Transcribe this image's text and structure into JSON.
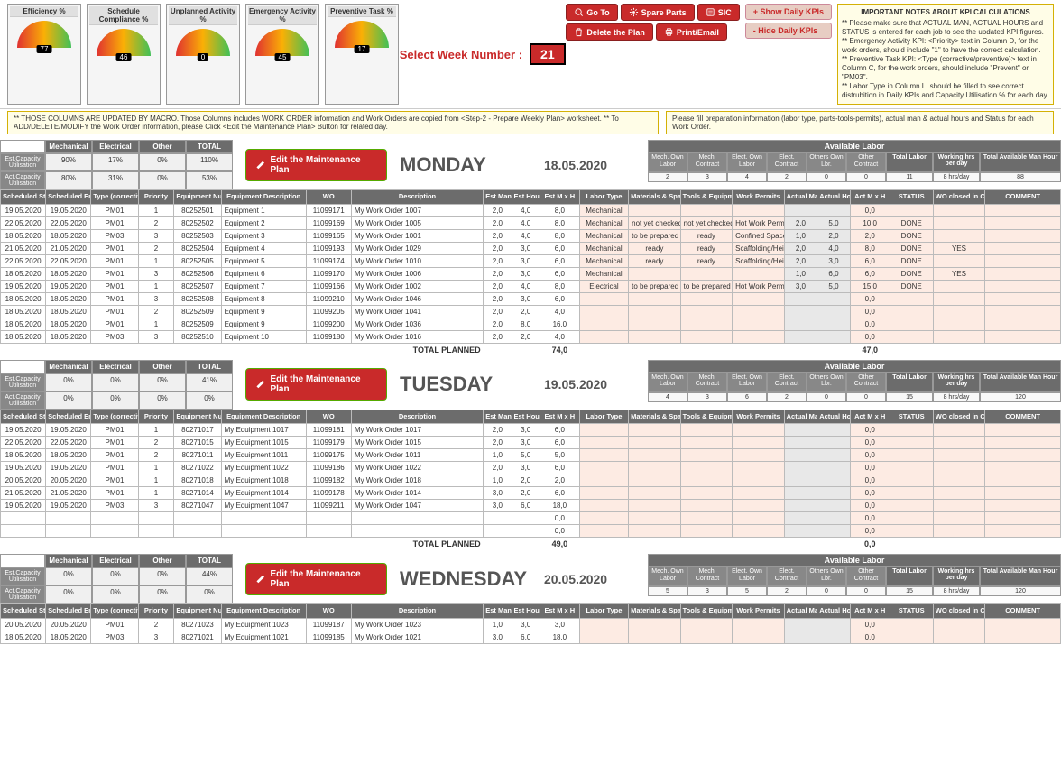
{
  "gauges": [
    {
      "title": "Efficiency %",
      "val": "77"
    },
    {
      "title": "Schedule Compliance %",
      "val": "46"
    },
    {
      "title": "Unplanned Activity %",
      "val": "0"
    },
    {
      "title": "Emergency Activity %",
      "val": "45"
    },
    {
      "title": "Preventive Task %",
      "val": "17"
    }
  ],
  "week_label": "Select Week Number :",
  "week_num": "21",
  "buttons": {
    "goto": "Go To",
    "spare": "Spare Parts",
    "sic": "SIC",
    "delete": "Delete the Plan",
    "print": "Print/Email",
    "show": "+ Show Daily KPIs",
    "hide": "- Hide Daily KPIs"
  },
  "notes": {
    "title": "IMPORTANT NOTES ABOUT KPI CALCULATIONS",
    "l1": "** Please make sure that ACTUAL MAN, ACTUAL HOURS and STATUS is entered for each job to see the updated KPI figures.",
    "l2": "** Emergency Activity KPI: <Priority> text in Column D, for the work orders, should include \"1\" to have the correct calculation.",
    "l3": "** Preventive Task KPI: <Type (corrective/preventive)> text in Column C, for the work orders, should include \"Prevent\" or \"PM03\".",
    "l4": "** Labor Type in Column L, should be filled to see correct distrubition in Daily KPIs and Capacity Utilisation % for each day."
  },
  "legend1": "** THOSE COLUMNS ARE UPDATED BY MACRO. Those Columns includes WORK ORDER information and Work Orders are copied from <Step-2 - Prepare Weekly Plan> worksheet. ** To ADD/DELETE/MODIFY the Work Order information, please Click <Edit the Maintenance Plan> Button for related day.",
  "legend2": "Please fill preparation information (labor type, parts-tools-permits), actual man & actual hours and Status for each Work Order.",
  "edit_label": "Edit the Maintenance Plan",
  "cap_cols": [
    "Mechanical",
    "Electrical",
    "Other",
    "TOTAL"
  ],
  "cap_rows": [
    "Est.Capacity Utilisation",
    "Act.Capacity Utilisation"
  ],
  "avail_title": "Available Labor",
  "avail_cols": [
    "Mech. Own Labor",
    "Mech. Contract",
    "Elect. Own Labor",
    "Elect. Contract",
    "Others Own Lbr.",
    "Other Contract",
    "Total Labor",
    "Working hrs per day",
    "Total Available Man Hour"
  ],
  "th": {
    "sd": "Scheduled Start Date",
    "ed": "Scheduled End Date",
    "type": "Type (corrective / preventive)",
    "pri": "Priority",
    "eqn": "Equipment Number",
    "eqd": "Equipment Description",
    "wo": "WO",
    "desc": "Description",
    "em": "Est Man",
    "eh": "Est Hour",
    "emh": "Est M x H",
    "lt": "Labor Type",
    "mat": "Materials & Spare Parts",
    "tool": "Tools & Equipment",
    "perm": "Work Permits",
    "am": "Actual Man",
    "ah": "Actual Hour",
    "amh": "Act M x H",
    "st": "STATUS",
    "cmms": "WO closed in CMMS?",
    "com": "COMMENT"
  },
  "total_label": "TOTAL PLANNED",
  "days": [
    {
      "name": "MONDAY",
      "date": "18.05.2020",
      "cap": [
        [
          "90%",
          "17%",
          "0%",
          "110%"
        ],
        [
          "80%",
          "31%",
          "0%",
          "53%"
        ]
      ],
      "avail": [
        "2",
        "3",
        "4",
        "2",
        "0",
        "0",
        "11",
        "8 hrs/day",
        "88"
      ],
      "rows": [
        [
          "19.05.2020",
          "19.05.2020",
          "PM01",
          "1",
          "80252501",
          "Equipment 1",
          "11099171",
          "My Work Order 1007",
          "2,0",
          "4,0",
          "8,0",
          "Mechanical",
          "",
          "",
          "",
          "",
          "",
          "0,0",
          "",
          "",
          ""
        ],
        [
          "22.05.2020",
          "22.05.2020",
          "PM01",
          "2",
          "80252502",
          "Equipment 2",
          "11099169",
          "My Work Order 1005",
          "2,0",
          "4,0",
          "8,0",
          "Mechanical",
          "not yet checked",
          "not yet checked",
          "Hot Work Permit",
          "2,0",
          "5,0",
          "10,0",
          "DONE",
          "",
          ""
        ],
        [
          "18.05.2020",
          "18.05.2020",
          "PM03",
          "3",
          "80252503",
          "Equipment 3",
          "11099165",
          "My Work Order 1001",
          "2,0",
          "4,0",
          "8,0",
          "Mechanical",
          "to be prepared",
          "ready",
          "Confined Spaces",
          "1,0",
          "2,0",
          "2,0",
          "DONE",
          "",
          ""
        ],
        [
          "21.05.2020",
          "21.05.2020",
          "PM01",
          "2",
          "80252504",
          "Equipment 4",
          "11099193",
          "My Work Order 1029",
          "2,0",
          "3,0",
          "6,0",
          "Mechanical",
          "ready",
          "ready",
          "Scaffolding/Heights",
          "2,0",
          "4,0",
          "8,0",
          "DONE",
          "YES",
          ""
        ],
        [
          "22.05.2020",
          "22.05.2020",
          "PM01",
          "1",
          "80252505",
          "Equipment 5",
          "11099174",
          "My Work Order 1010",
          "2,0",
          "3,0",
          "6,0",
          "Mechanical",
          "ready",
          "ready",
          "Scaffolding/Heights",
          "2,0",
          "3,0",
          "6,0",
          "DONE",
          "",
          ""
        ],
        [
          "18.05.2020",
          "18.05.2020",
          "PM01",
          "3",
          "80252506",
          "Equipment 6",
          "11099170",
          "My Work Order 1006",
          "2,0",
          "3,0",
          "6,0",
          "Mechanical",
          "",
          "",
          "",
          "1,0",
          "6,0",
          "6,0",
          "DONE",
          "YES",
          ""
        ],
        [
          "19.05.2020",
          "19.05.2020",
          "PM01",
          "1",
          "80252507",
          "Equipment 7",
          "11099166",
          "My Work Order 1002",
          "2,0",
          "4,0",
          "8,0",
          "Electrical",
          "to be prepared",
          "to be prepared",
          "Hot Work Permit",
          "3,0",
          "5,0",
          "15,0",
          "DONE",
          "",
          ""
        ],
        [
          "18.05.2020",
          "18.05.2020",
          "PM01",
          "3",
          "80252508",
          "Equipment 8",
          "11099210",
          "My Work Order 1046",
          "2,0",
          "3,0",
          "6,0",
          "",
          "",
          "",
          "",
          "",
          "",
          "0,0",
          "",
          "",
          ""
        ],
        [
          "18.05.2020",
          "18.05.2020",
          "PM01",
          "2",
          "80252509",
          "Equipment 9",
          "11099205",
          "My Work Order 1041",
          "2,0",
          "2,0",
          "4,0",
          "",
          "",
          "",
          "",
          "",
          "",
          "0,0",
          "",
          "",
          ""
        ],
        [
          "18.05.2020",
          "18.05.2020",
          "PM01",
          "1",
          "80252509",
          "Equipment 9",
          "11099200",
          "My Work Order 1036",
          "2,0",
          "8,0",
          "16,0",
          "",
          "",
          "",
          "",
          "",
          "",
          "0,0",
          "",
          "",
          ""
        ],
        [
          "18.05.2020",
          "18.05.2020",
          "PM03",
          "3",
          "80252510",
          "Equipment 10",
          "11099180",
          "My Work Order 1016",
          "2,0",
          "2,0",
          "4,0",
          "",
          "",
          "",
          "",
          "",
          "",
          "0,0",
          "",
          "",
          ""
        ]
      ],
      "total_est": "74,0",
      "total_act": "47,0"
    },
    {
      "name": "TUESDAY",
      "date": "19.05.2020",
      "cap": [
        [
          "0%",
          "0%",
          "0%",
          "41%"
        ],
        [
          "0%",
          "0%",
          "0%",
          "0%"
        ]
      ],
      "avail": [
        "4",
        "3",
        "6",
        "2",
        "0",
        "0",
        "15",
        "8 hrs/day",
        "120"
      ],
      "rows": [
        [
          "19.05.2020",
          "19.05.2020",
          "PM01",
          "1",
          "80271017",
          "My Equipment 1017",
          "11099181",
          "My Work Order 1017",
          "2,0",
          "3,0",
          "6,0",
          "",
          "",
          "",
          "",
          "",
          "",
          "0,0",
          "",
          "",
          ""
        ],
        [
          "22.05.2020",
          "22.05.2020",
          "PM01",
          "2",
          "80271015",
          "My Equipment 1015",
          "11099179",
          "My Work Order 1015",
          "2,0",
          "3,0",
          "6,0",
          "",
          "",
          "",
          "",
          "",
          "",
          "0,0",
          "",
          "",
          ""
        ],
        [
          "18.05.2020",
          "18.05.2020",
          "PM01",
          "2",
          "80271011",
          "My Equipment 1011",
          "11099175",
          "My Work Order 1011",
          "1,0",
          "5,0",
          "5,0",
          "",
          "",
          "",
          "",
          "",
          "",
          "0,0",
          "",
          "",
          ""
        ],
        [
          "19.05.2020",
          "19.05.2020",
          "PM01",
          "1",
          "80271022",
          "My Equipment 1022",
          "11099186",
          "My Work Order 1022",
          "2,0",
          "3,0",
          "6,0",
          "",
          "",
          "",
          "",
          "",
          "",
          "0,0",
          "",
          "",
          ""
        ],
        [
          "20.05.2020",
          "20.05.2020",
          "PM01",
          "1",
          "80271018",
          "My Equipment 1018",
          "11099182",
          "My Work Order 1018",
          "1,0",
          "2,0",
          "2,0",
          "",
          "",
          "",
          "",
          "",
          "",
          "0,0",
          "",
          "",
          ""
        ],
        [
          "21.05.2020",
          "21.05.2020",
          "PM01",
          "1",
          "80271014",
          "My Equipment 1014",
          "11099178",
          "My Work Order 1014",
          "3,0",
          "2,0",
          "6,0",
          "",
          "",
          "",
          "",
          "",
          "",
          "0,0",
          "",
          "",
          ""
        ],
        [
          "19.05.2020",
          "19.05.2020",
          "PM03",
          "3",
          "80271047",
          "My Equipment 1047",
          "11099211",
          "My Work Order 1047",
          "3,0",
          "6,0",
          "18,0",
          "",
          "",
          "",
          "",
          "",
          "",
          "0,0",
          "",
          "",
          ""
        ],
        [
          "",
          "",
          "",
          "",
          "",
          "",
          "",
          "",
          "",
          "",
          "0,0",
          "",
          "",
          "",
          "",
          "",
          "",
          "0,0",
          "",
          "",
          ""
        ],
        [
          "",
          "",
          "",
          "",
          "",
          "",
          "",
          "",
          "",
          "",
          "0,0",
          "",
          "",
          "",
          "",
          "",
          "",
          "0,0",
          "",
          "",
          ""
        ]
      ],
      "total_est": "49,0",
      "total_act": "0,0"
    },
    {
      "name": "WEDNESDAY",
      "date": "20.05.2020",
      "cap": [
        [
          "0%",
          "0%",
          "0%",
          "44%"
        ],
        [
          "0%",
          "0%",
          "0%",
          "0%"
        ]
      ],
      "avail": [
        "5",
        "3",
        "5",
        "2",
        "0",
        "0",
        "15",
        "8 hrs/day",
        "120"
      ],
      "rows": [
        [
          "20.05.2020",
          "20.05.2020",
          "PM01",
          "2",
          "80271023",
          "My Equipment 1023",
          "11099187",
          "My Work Order 1023",
          "1,0",
          "3,0",
          "3,0",
          "",
          "",
          "",
          "",
          "",
          "",
          "0,0",
          "",
          "",
          ""
        ],
        [
          "18.05.2020",
          "18.05.2020",
          "PM03",
          "3",
          "80271021",
          "My Equipment 1021",
          "11099185",
          "My Work Order 1021",
          "3,0",
          "6,0",
          "18,0",
          "",
          "",
          "",
          "",
          "",
          "",
          "0,0",
          "",
          "",
          ""
        ]
      ],
      "total_est": "",
      "total_act": ""
    }
  ]
}
